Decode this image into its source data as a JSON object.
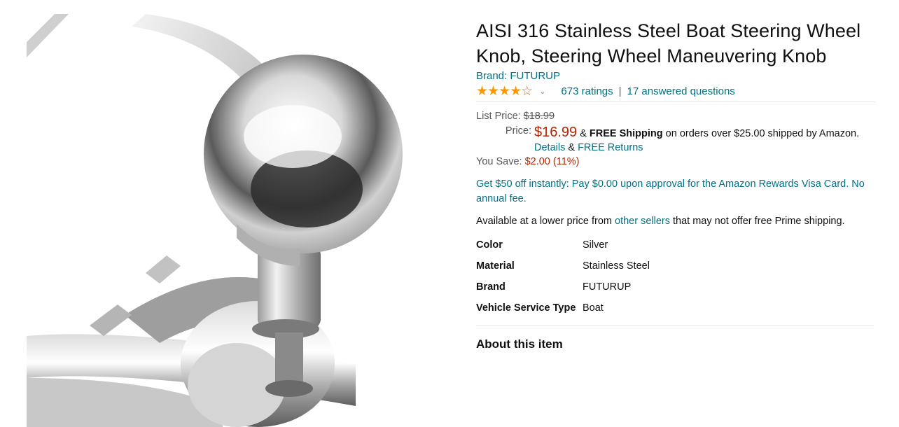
{
  "product": {
    "title": "AISI 316 Stainless Steel Boat Steering Wheel Knob, Steering Wheel Maneuvering Knob",
    "brand_label": "Brand: FUTURUP",
    "rating": {
      "stars": 3.9,
      "stars_filled": "★★★★",
      "stars_empty": "☆",
      "ratings_text": "673 ratings",
      "separator": "|",
      "questions_text": "17 answered questions"
    },
    "image_description": "chrome-steering-knob-photo"
  },
  "price": {
    "list_label": "List Price:",
    "list_value": "$18.99",
    "price_label": "Price:",
    "price_value": "$16.99",
    "amp1": "&",
    "free_shipping": "FREE Shipping",
    "shipping_text": "on orders over $25.00 shipped by Amazon.",
    "details_link": "Details",
    "amp2": "&",
    "free_returns": "FREE Returns",
    "save_label": "You Save:",
    "save_value": "$2.00 (11%)"
  },
  "promo": "Get $50 off instantly: Pay $0.00 upon approval for the Amazon Rewards Visa Card. No annual fee.",
  "availability": {
    "pre": "Available at a lower price from",
    "link": "other sellers",
    "post": "that may not offer free Prime shipping."
  },
  "specs": [
    {
      "key": "Color",
      "value": "Silver"
    },
    {
      "key": "Material",
      "value": "Stainless Steel"
    },
    {
      "key": "Brand",
      "value": "FUTURUP"
    },
    {
      "key": "Vehicle Service Type",
      "value": "Boat"
    }
  ],
  "about_heading": "About this item",
  "colors": {
    "link": "#007185",
    "price": "#b12704",
    "star": "#ff9900"
  }
}
